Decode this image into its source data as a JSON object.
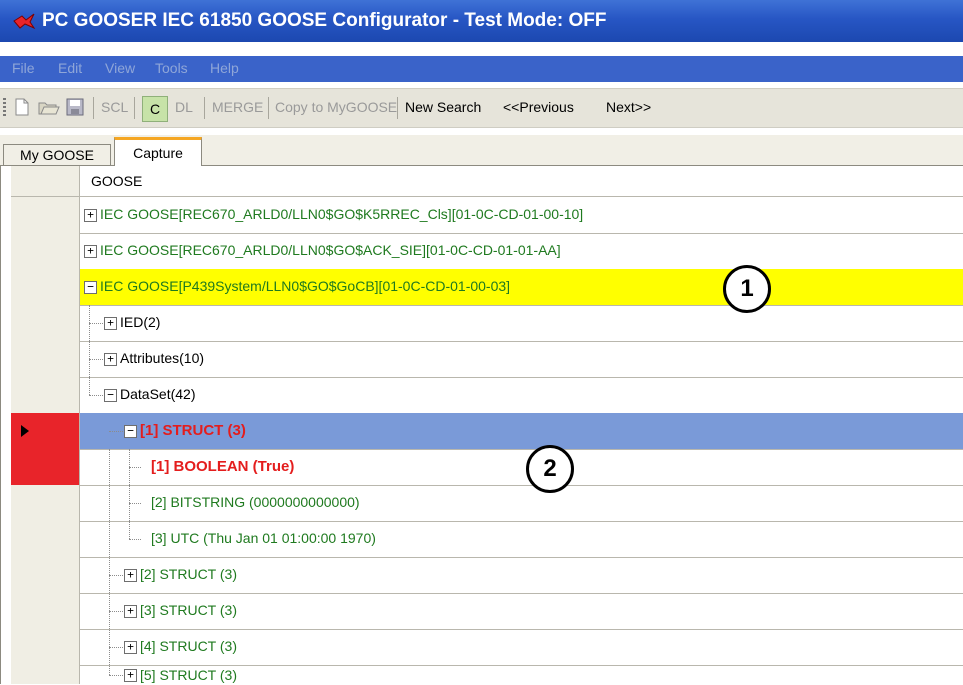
{
  "window": {
    "title": "PC GOOSER  IEC 61850 GOOSE Configurator - Test Mode: OFF",
    "logo_icon": "pc-gooser-logo-icon"
  },
  "menu": [
    "File",
    "Edit",
    "View",
    "Tools",
    "Help"
  ],
  "toolbar": {
    "new_icon": "new-file-icon",
    "open_icon": "open-folder-icon",
    "save_icon": "save-disk-icon",
    "scl": "SCL",
    "c": "C",
    "dl": "DL",
    "merge": "MERGE",
    "copy_to_mygoose": "Copy to MyGOOSE",
    "new_search": "New Search",
    "previous": "<<Previous",
    "next": "Next>>"
  },
  "tabs": [
    "My GOOSE",
    "Capture"
  ],
  "grid": {
    "header": "GOOSE",
    "rows": [
      "IEC GOOSE[REC670_ARLD0/LLN0$GO$K5RREC_Cls][01-0C-CD-01-00-10]",
      "IEC GOOSE[REC670_ARLD0/LLN0$GO$ACK_SIE][01-0C-CD-01-01-AA]",
      "IEC GOOSE[P439System/LLN0$GO$GoCB][01-0C-CD-01-00-03]",
      "IED(2)",
      "Attributes(10)",
      "DataSet(42)",
      "[1] STRUCT (3)",
      "[1] BOOLEAN   (True)",
      "[2] BITSTRING  (0000000000000)",
      "[3] UTC  (Thu Jan 01 01:00:00 1970)",
      "[2] STRUCT (3)",
      "[3] STRUCT (3)",
      "[4] STRUCT (3)",
      "[5] STRUCT (3)"
    ]
  },
  "callouts": [
    "1",
    "2"
  ],
  "colors": {
    "highlight_row": "#ffff00",
    "selected_row": "#7a9ad8",
    "error_text": "#e41d1d",
    "tree_text": "#1f7a1f",
    "row_marker": "#e8242a"
  }
}
